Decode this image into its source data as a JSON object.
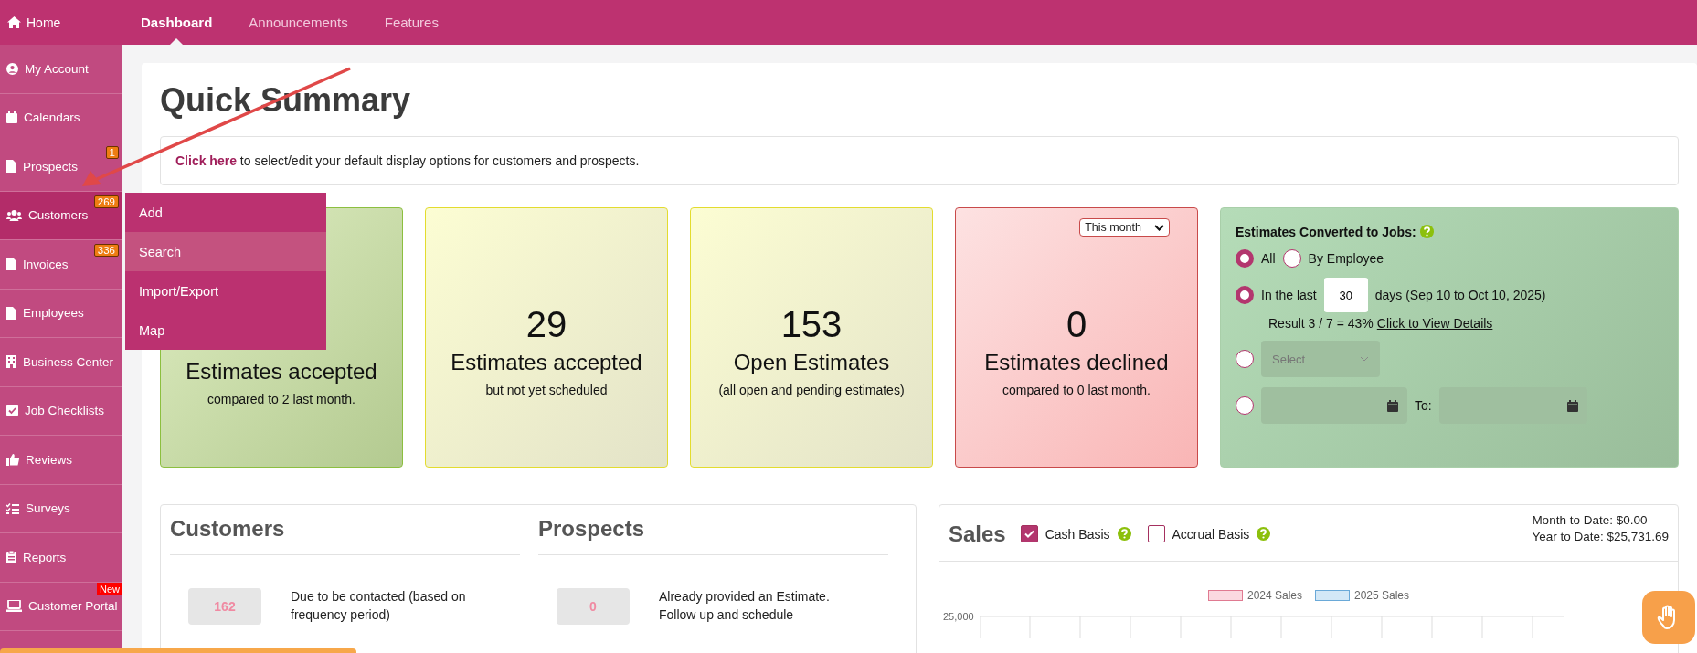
{
  "topbar": {
    "home": "Home",
    "tabs": [
      {
        "label": "Dashboard",
        "selected": true
      },
      {
        "label": "Announcements",
        "selected": false
      },
      {
        "label": "Features",
        "selected": false
      }
    ]
  },
  "sidebar": {
    "items": [
      {
        "label": "My Account",
        "selected": false
      },
      {
        "label": "Calendars",
        "selected": false
      },
      {
        "label": "Prospects",
        "badge": "1",
        "selected": false
      },
      {
        "label": "Customers",
        "badge": "269",
        "selected": true
      },
      {
        "label": "Invoices",
        "badge": "336",
        "selected": false
      },
      {
        "label": "Employees",
        "selected": false
      },
      {
        "label": "Business Center",
        "selected": false
      },
      {
        "label": "Job Checklists",
        "selected": false
      },
      {
        "label": "Reviews",
        "selected": false
      },
      {
        "label": "Surveys",
        "selected": false
      },
      {
        "label": "Reports",
        "selected": false
      },
      {
        "label": "Customer Portal",
        "tag": "New",
        "selected": false
      }
    ]
  },
  "flyout_menu": {
    "items": [
      {
        "label": "Add",
        "selected": false
      },
      {
        "label": "Search",
        "selected": true
      },
      {
        "label": "Import/Export",
        "selected": false
      },
      {
        "label": "Map",
        "selected": false
      }
    ]
  },
  "page_title": "Quick Summary",
  "notice": {
    "link": "Click here",
    "text": " to select/edit your default display options for customers and prospects."
  },
  "cards": [
    {
      "kind": "green",
      "title": "Estimates accepted",
      "note": "compared to 2 last month."
    },
    {
      "kind": "yellow",
      "number": "29",
      "title": "Estimates accepted",
      "note": "but not yet scheduled"
    },
    {
      "kind": "yellow",
      "number": "153",
      "title": "Open Estimates",
      "note": "(all open and pending estimates)"
    },
    {
      "kind": "red",
      "period": "This month",
      "number": "0",
      "title": "Estimates declined",
      "note": "compared to 0 last month."
    }
  ],
  "conversion": {
    "title": "Estimates Converted to Jobs:",
    "scope": [
      {
        "label": "All",
        "selected": true
      },
      {
        "label": "By Employee",
        "selected": false
      }
    ],
    "last_days": {
      "selected": true,
      "label": "In the last",
      "value": "30",
      "suffix": "days (Sep 10 to Oct 10, 2025)"
    },
    "result": "Result 3 / 7 = 43%",
    "details_link": "Click to View Details",
    "employee": {
      "selected": false,
      "placeholder": "Select"
    },
    "date_range": {
      "selected": false,
      "to_label": "To:"
    }
  },
  "customers": {
    "title": "Customers",
    "items": [
      {
        "count": "162",
        "text": "Due to be contacted (based on frequency period)"
      }
    ]
  },
  "prospects": {
    "title": "Prospects",
    "items": [
      {
        "count": "0",
        "text": "Already provided an Estimate. Follow up and schedule"
      }
    ]
  },
  "sales": {
    "title": "Sales",
    "options": [
      {
        "label": "Cash Basis",
        "checked": true
      },
      {
        "label": "Accrual Basis",
        "checked": false
      }
    ],
    "totals": [
      "Month to Date: $0.00",
      "Year to Date: $25,731.69"
    ],
    "legend": [
      {
        "label": "2024 Sales",
        "color": "#fbd9e0"
      },
      {
        "label": "2025 Sales",
        "color": "#d3e8f7"
      }
    ],
    "y_tick": "25,000"
  }
}
